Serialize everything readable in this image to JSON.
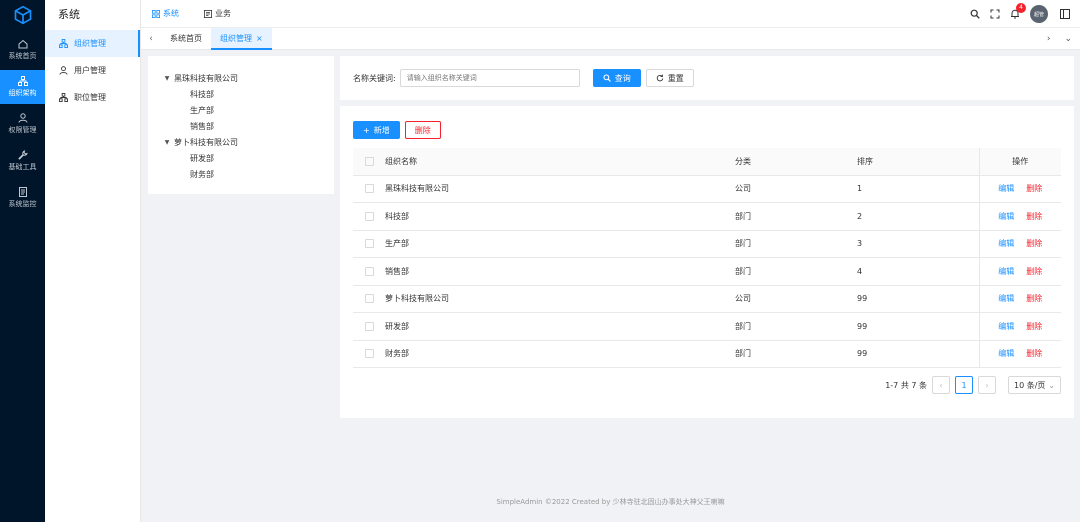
{
  "rail": {
    "items": [
      {
        "label": "系统首页",
        "icon": "home-icon"
      },
      {
        "label": "组织架构",
        "icon": "org-icon",
        "active": true
      },
      {
        "label": "权限管理",
        "icon": "user-icon"
      },
      {
        "label": "基础工具",
        "icon": "wrench-icon"
      },
      {
        "label": "系统监控",
        "icon": "doc-icon"
      }
    ]
  },
  "sidebar": {
    "title": "系统",
    "items": [
      {
        "label": "组织管理",
        "active": true
      },
      {
        "label": "用户管理"
      },
      {
        "label": "职位管理"
      }
    ]
  },
  "header": {
    "nav": [
      {
        "label": "系统",
        "active": true
      },
      {
        "label": "业务"
      }
    ],
    "badge_count": "4",
    "avatar_text": "超管"
  },
  "tabs": [
    {
      "label": "系统首页"
    },
    {
      "label": "组织管理",
      "active": true,
      "close": "×"
    }
  ],
  "tree": {
    "nodes": [
      {
        "label": "黑珠科技有限公司",
        "level": 0
      },
      {
        "label": "科技部",
        "level": 1
      },
      {
        "label": "生产部",
        "level": 1
      },
      {
        "label": "销售部",
        "level": 1
      },
      {
        "label": "萝卜科技有限公司",
        "level": 0
      },
      {
        "label": "研发部",
        "level": 1
      },
      {
        "label": "财务部",
        "level": 1
      }
    ]
  },
  "search": {
    "label": "名称关键词:",
    "placeholder": "请输入组织名称关键词",
    "query_label": "查询",
    "reset_label": "重置"
  },
  "toolbar": {
    "add_label": "新增",
    "delete_label": "删除"
  },
  "table": {
    "headers": {
      "name": "组织名称",
      "type": "分类",
      "sort": "排序",
      "op": "操作"
    },
    "rows": [
      {
        "name": "黑珠科技有限公司",
        "type": "公司",
        "sort": "1"
      },
      {
        "name": "科技部",
        "type": "部门",
        "sort": "2"
      },
      {
        "name": "生产部",
        "type": "部门",
        "sort": "3"
      },
      {
        "name": "销售部",
        "type": "部门",
        "sort": "4"
      },
      {
        "name": "萝卜科技有限公司",
        "type": "公司",
        "sort": "99"
      },
      {
        "name": "研发部",
        "type": "部门",
        "sort": "99"
      },
      {
        "name": "财务部",
        "type": "部门",
        "sort": "99"
      }
    ],
    "edit_label": "编辑",
    "delete_label": "删除"
  },
  "pager": {
    "summary": "1-7 共 7 条",
    "current": "1",
    "page_size": "10 条/页"
  },
  "footer": "SimpleAdmin ©2022 Created by 少林寺驻北固山办事处大神父王喇嘛"
}
